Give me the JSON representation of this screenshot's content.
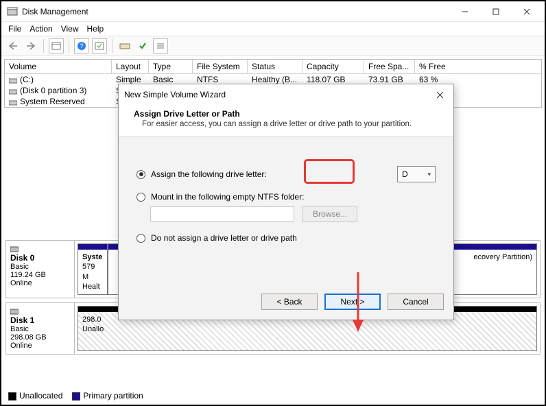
{
  "window": {
    "title": "Disk Management"
  },
  "menu": {
    "file": "File",
    "action": "Action",
    "view": "View",
    "help": "Help"
  },
  "table": {
    "headers": {
      "volume": "Volume",
      "layout": "Layout",
      "type": "Type",
      "fs": "File System",
      "status": "Status",
      "capacity": "Capacity",
      "free": "Free Spa...",
      "pct": "% Free"
    },
    "rows": [
      {
        "volume": "(C:)",
        "layout": "Simple",
        "type": "Basic",
        "fs": "NTFS",
        "status": "Healthy (B...",
        "capacity": "118.07 GB",
        "free": "73.91 GB",
        "pct": "63 %"
      },
      {
        "volume": "(Disk 0 partition 3)",
        "layout": "Si",
        "type": "",
        "fs": "",
        "status": "",
        "capacity": "",
        "free": "",
        "pct": ""
      },
      {
        "volume": "System Reserved",
        "layout": "Si",
        "type": "",
        "fs": "",
        "status": "",
        "capacity": "",
        "free": "",
        "pct": ""
      }
    ]
  },
  "disks": [
    {
      "name": "Disk 0",
      "type": "Basic",
      "size": "119.24 GB",
      "status": "Online",
      "parts": [
        {
          "label": "Syste",
          "line2": "579 M",
          "line3": "Healt",
          "stripe": "#1b0e8f"
        },
        {
          "label": "",
          "line2": "",
          "line3": "",
          "stripe": "#1b0e8f",
          "tail": "ecovery Partition)"
        }
      ]
    },
    {
      "name": "Disk 1",
      "type": "Basic",
      "size": "298.08 GB",
      "status": "Online",
      "parts": [
        {
          "label": "298.0",
          "line2": "Unallo",
          "line3": "",
          "stripe": "#000000",
          "hatched": true
        }
      ]
    }
  ],
  "legend": {
    "unalloc": "Unallocated",
    "primary": "Primary partition"
  },
  "dialog": {
    "title": "New Simple Volume Wizard",
    "heading": "Assign Drive Letter or Path",
    "subheading": "For easier access, you can assign a drive letter or drive path to your partition.",
    "opt_assign": "Assign the following drive letter:",
    "drive": "D",
    "opt_mount": "Mount in the following empty NTFS folder:",
    "browse": "Browse...",
    "opt_none": "Do not assign a drive letter or drive path",
    "back": "< Back",
    "next": "Next >",
    "cancel": "Cancel"
  }
}
